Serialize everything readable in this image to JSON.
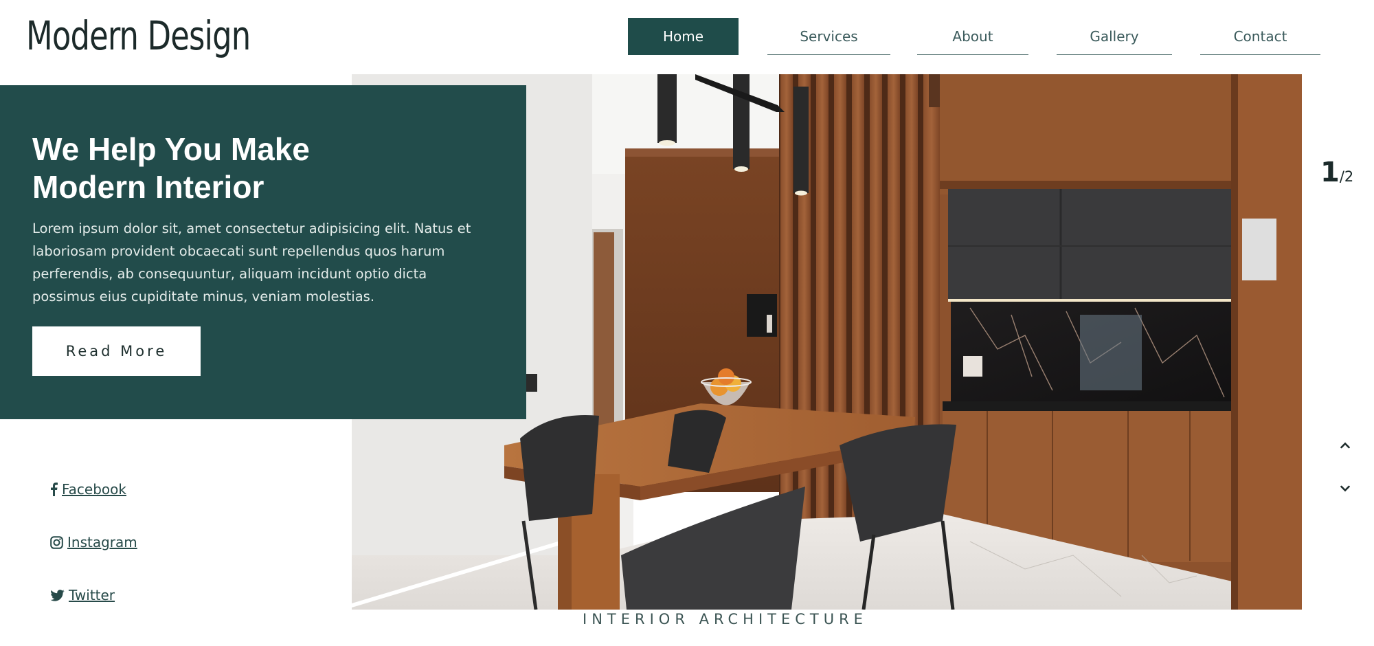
{
  "header": {
    "brand": "Modern Design",
    "nav": [
      {
        "label": "Home",
        "active": true
      },
      {
        "label": "Services",
        "active": false
      },
      {
        "label": "About",
        "active": false
      },
      {
        "label": "Gallery",
        "active": false
      },
      {
        "label": "Contact",
        "active": false
      }
    ]
  },
  "hero": {
    "title": "We Help You Make Modern Interior",
    "body": "Lorem ipsum dolor sit, amet consectetur adipisicing elit. Natus et laboriosam provident obcaecati sunt repellendus quos harum perferendis, ab consequuntur, aliquam incidunt optio dicta possimus eius cupiditate minus, veniam molestias.",
    "cta_label": "Read More",
    "tagline": "INTERIOR ARCHITECTURE"
  },
  "slider": {
    "current": "1",
    "total": "/2",
    "up_icon": "chevron-up-icon",
    "down_icon": "chevron-down-icon"
  },
  "socials": [
    {
      "label": " Facebook",
      "icon": "facebook-icon"
    },
    {
      "label": " Instagram",
      "icon": "instagram-icon"
    },
    {
      "label": " Twitter",
      "icon": "twitter-icon"
    }
  ],
  "colors": {
    "accent": "#224c4b",
    "nav_active": "#1f4c4a",
    "text_dark": "#1c2a2a"
  }
}
